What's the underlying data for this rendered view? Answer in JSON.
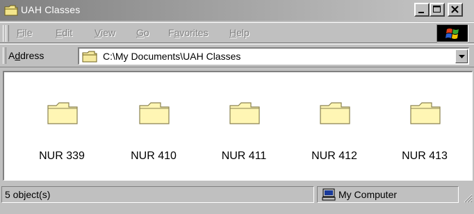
{
  "window": {
    "title": "UAH Classes"
  },
  "caption_buttons": {
    "minimize": "minimize-icon",
    "maximize": "maximize-icon",
    "close": "close-icon"
  },
  "menu": {
    "items": [
      {
        "pre": "",
        "key": "F",
        "post": "ile"
      },
      {
        "pre": "",
        "key": "E",
        "post": "dit"
      },
      {
        "pre": "",
        "key": "V",
        "post": "iew"
      },
      {
        "pre": "",
        "key": "G",
        "post": "o"
      },
      {
        "pre": "F",
        "key": "a",
        "post": "vorites"
      },
      {
        "pre": "",
        "key": "H",
        "post": "elp"
      }
    ]
  },
  "address": {
    "label_pre": "A",
    "label_key": "d",
    "label_post": "dress",
    "value": "C:\\My Documents\\UAH Classes"
  },
  "folders": [
    {
      "name": "NUR 339"
    },
    {
      "name": "NUR 410"
    },
    {
      "name": "NUR 411"
    },
    {
      "name": "NUR 412"
    },
    {
      "name": "NUR 413"
    }
  ],
  "status": {
    "objects": "5 object(s)",
    "location": "My Computer"
  },
  "colors": {
    "folder_fill": "#fff8b0",
    "folder_stroke": "#7a7a50",
    "face": "#c0c0c0"
  }
}
